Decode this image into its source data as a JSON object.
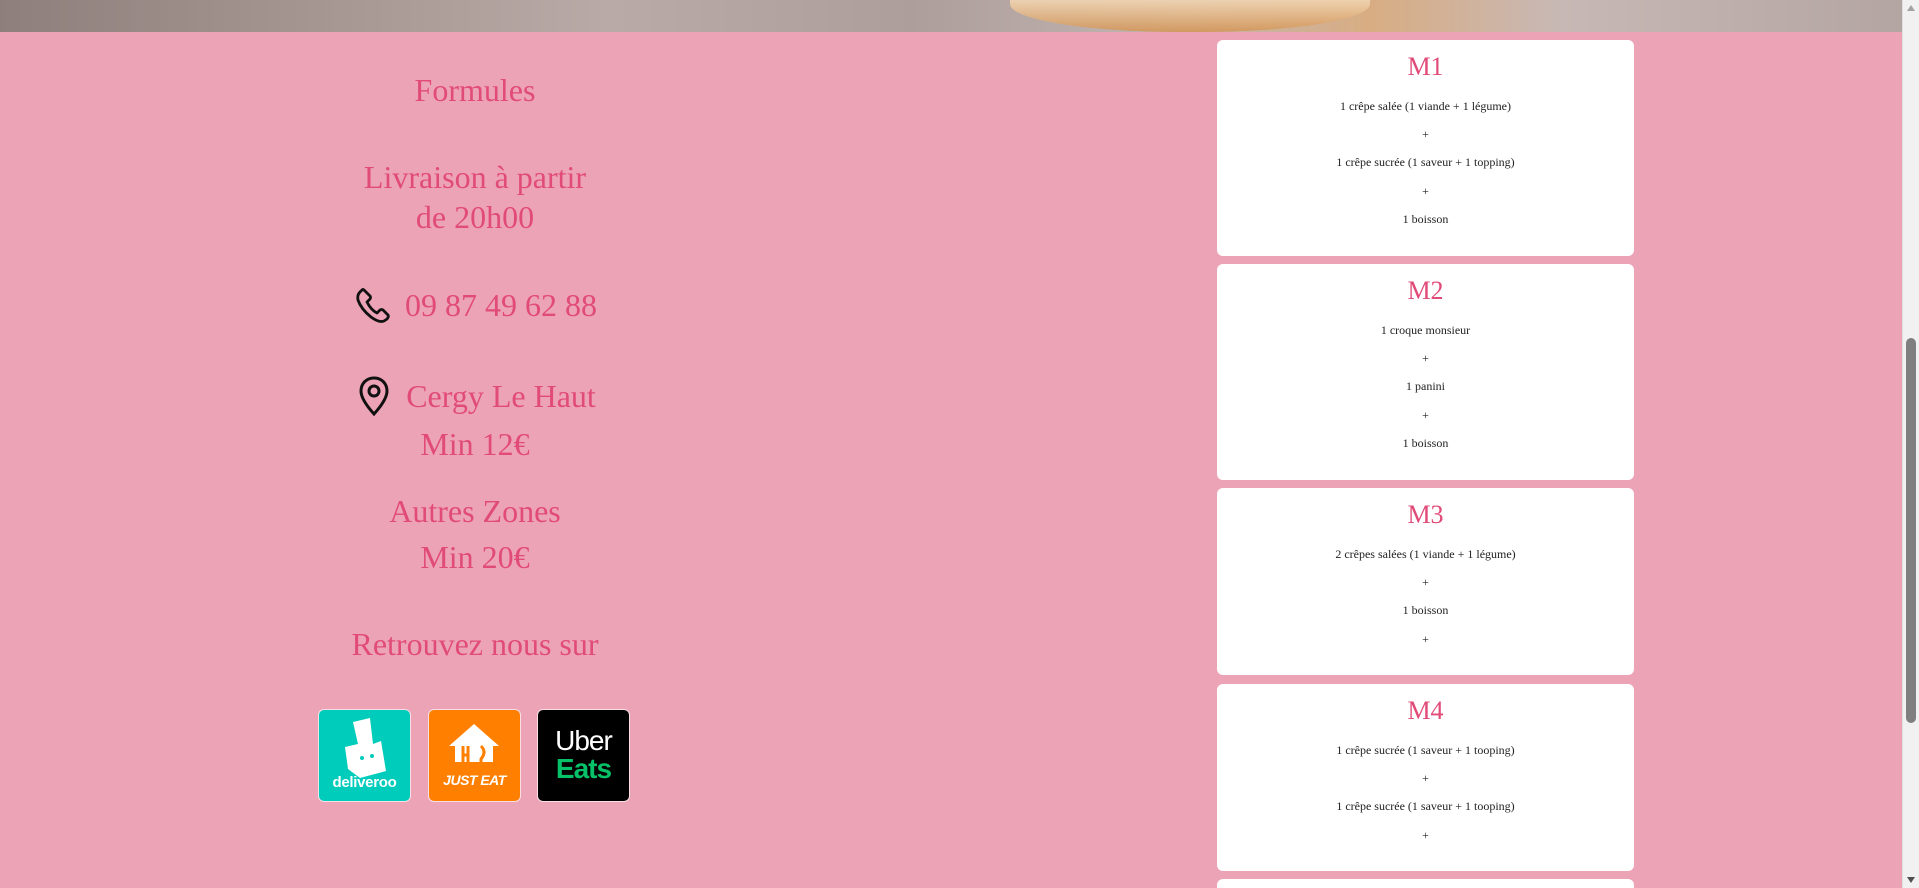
{
  "hero": {
    "description_visible": false
  },
  "info": {
    "formules_label": "Formules",
    "delivery_line_1": "Livraison à partir",
    "delivery_line_2": "de 20h00",
    "phone": "09 87 49 62 88",
    "phone_icon": "phone-icon",
    "location": "Cergy Le Haut",
    "location_icon": "location-pin-icon",
    "location_min": "Min 12€",
    "other_zones": "Autres Zones",
    "other_zones_min": "Min 20€",
    "find_us": "Retrouvez nous sur"
  },
  "apps": [
    {
      "name": "deliveroo",
      "label": "deliveroo",
      "icon": "deliveroo-logo-icon",
      "color": "#00ccbc"
    },
    {
      "name": "just-eat",
      "label": "JUST EAT",
      "icon": "just-eat-logo-icon",
      "color": "#ff8000"
    },
    {
      "name": "uber-eats",
      "label_line_1": "Uber",
      "label_line_2": "Eats",
      "icon": "uber-eats-logo-icon",
      "color": "#000000",
      "accent": "#06c167"
    }
  ],
  "menus": [
    {
      "title": "M1",
      "lines": [
        "1 crêpe salée (1 viande + 1 légume)",
        "+",
        "1 crêpe sucrée (1 saveur + 1 topping)",
        "+",
        "1 boisson"
      ]
    },
    {
      "title": "M2",
      "lines": [
        "1 croque monsieur",
        "+",
        "1 panini",
        "+",
        "1 boisson"
      ]
    },
    {
      "title": "M3",
      "lines": [
        "2 crêpes salées (1 viande + 1 légume)",
        "+",
        "1 boisson",
        "+"
      ]
    },
    {
      "title": "M4",
      "lines": [
        "1 crêpe sucrée (1 saveur + 1 tooping)",
        "+",
        "1 crêpe sucrée (1 saveur + 1 tooping)",
        "+"
      ]
    }
  ],
  "colors": {
    "background": "#eda3b6",
    "accent": "#e14b78",
    "card": "#ffffff",
    "text": "#222222"
  },
  "scrollbar": {
    "position_fraction": 0.43
  }
}
